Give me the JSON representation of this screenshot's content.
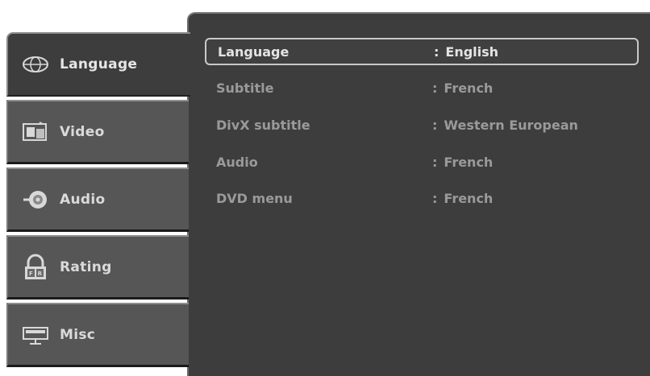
{
  "sidebar": {
    "tabs": [
      {
        "label": "Language",
        "icon": "language-icon"
      },
      {
        "label": "Video",
        "icon": "video-icon"
      },
      {
        "label": "Audio",
        "icon": "audio-icon"
      },
      {
        "label": "Rating",
        "icon": "rating-lock-icon"
      },
      {
        "label": "Misc",
        "icon": "misc-icon"
      }
    ],
    "active_tab": "Language"
  },
  "settings": {
    "separator": ":",
    "rows": [
      {
        "label": "Language",
        "value": "English"
      },
      {
        "label": "Subtitle",
        "value": "French"
      },
      {
        "label": "DivX subtitle",
        "value": "Western European"
      },
      {
        "label": "Audio",
        "value": "French"
      },
      {
        "label": "DVD menu",
        "value": "French"
      }
    ],
    "selected_row": "Language"
  },
  "colors": {
    "panel_bg": "#3d3d3d",
    "tab_bg": "#565656",
    "text_highlight": "#e4e4e4",
    "text_dim": "#9a9a9a"
  }
}
